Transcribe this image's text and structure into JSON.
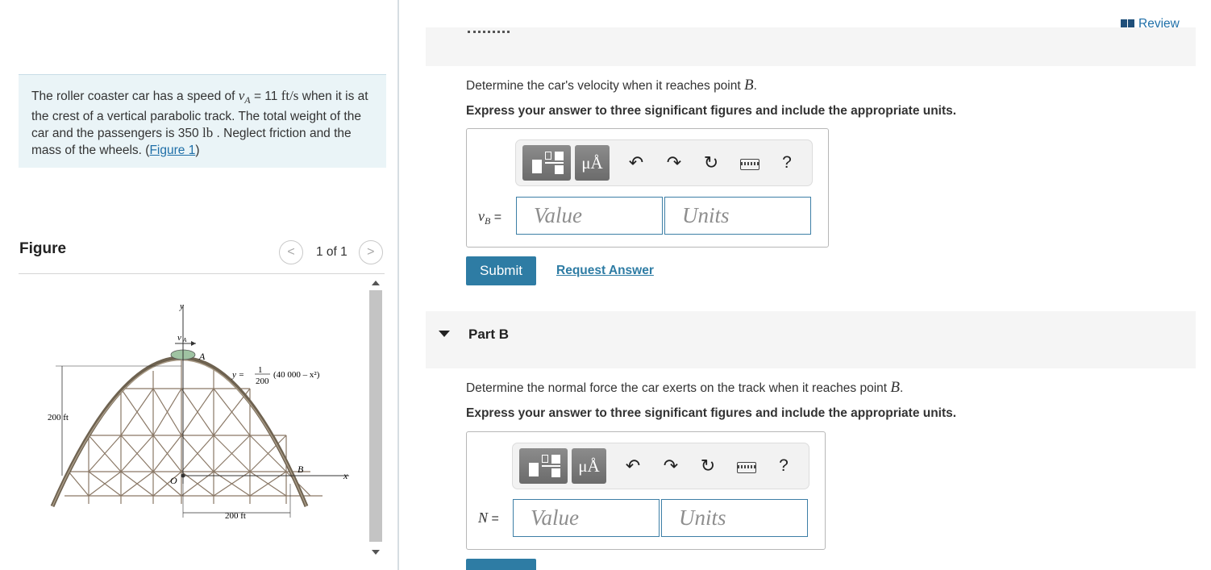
{
  "problem": {
    "text_1": "The roller coaster car has a speed of ",
    "speed_var": "v",
    "speed_sub": "A",
    "speed_value": " = 11 ",
    "speed_unit": "ft/s",
    "text_2": " when it is at the crest of a vertical parabolic track. The total weight of the car and the passengers is 350 ",
    "weight_unit": "lb",
    "text_3": " . Neglect friction and the mass of the wheels. (",
    "figure_link": "Figure 1",
    "text_4": ")"
  },
  "figure": {
    "title": "Figure",
    "counter": "1 of 1",
    "prev_glyph": "<",
    "next_glyph": ">",
    "labels": {
      "y_axis": "y",
      "velocity": "v",
      "velocity_sub": "A",
      "point_a": "A",
      "equation": "y = ",
      "eq_num": "1",
      "eq_den": "200",
      "eq_rest": "(40 000 – x²)",
      "height": "200 ft",
      "origin": "O",
      "point_b": "B",
      "x_axis": "x",
      "width": "200 ft"
    }
  },
  "review": {
    "label": "Review"
  },
  "partA": {
    "question_pre": "Determine the car's velocity when it reaches point ",
    "question_point": "B",
    "question_post": ".",
    "instruction": "Express your answer to three significant figures and include the appropriate units.",
    "var_name": "v",
    "var_sub": "B",
    "equals": " =",
    "value_placeholder": "Value",
    "units_placeholder": "Units",
    "submit": "Submit",
    "request": "Request Answer"
  },
  "partB": {
    "title": "Part B",
    "question_pre": "Determine the normal force the car exerts on the track when it reaches point ",
    "question_point": "B",
    "question_post": ".",
    "instruction": "Express your answer to three significant figures and include the appropriate units.",
    "var_name": "N",
    "equals": " =",
    "value_placeholder": "Value",
    "units_placeholder": "Units"
  },
  "toolbar": {
    "mu_label": "μÅ",
    "undo_glyph": "↶",
    "redo_glyph": "↷",
    "reset_glyph": "↻",
    "help_glyph": "?"
  },
  "colors": {
    "accent": "#2e7ca4",
    "link": "#1f6fa8",
    "problem_bg": "#eaf4f7",
    "track": "#7a6a58"
  }
}
